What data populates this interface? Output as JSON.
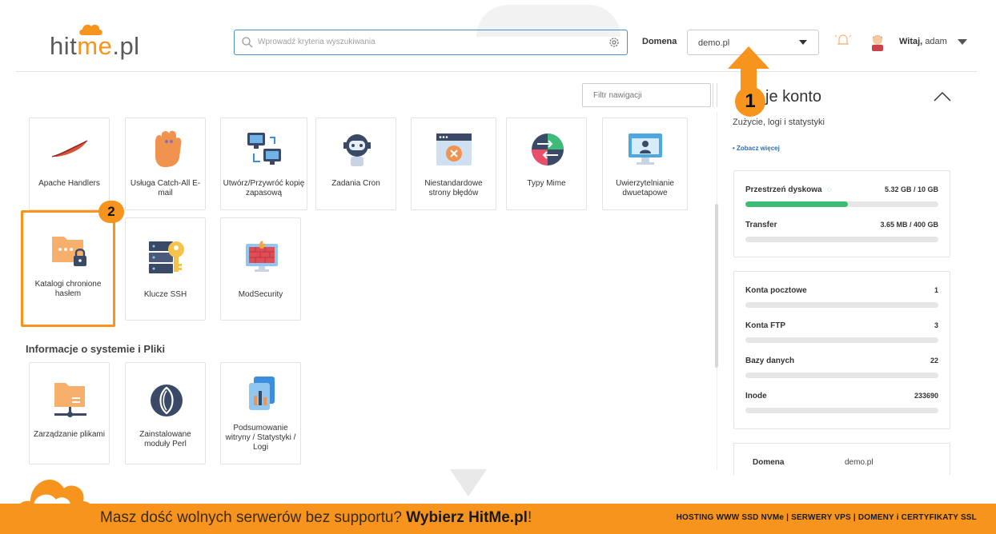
{
  "header": {
    "logo": {
      "part1": "hit",
      "part2": "me",
      "part3": ".pl"
    },
    "search": {
      "placeholder": "Wprowadź kryteria wyszukiwania"
    },
    "domain_label": "Domena",
    "domain_value": "demo.pl",
    "welcome_prefix": "Witaj,",
    "welcome_user": "adam"
  },
  "callouts": {
    "one": "1",
    "two": "2"
  },
  "filter": {
    "placeholder": "Filtr nawigacji"
  },
  "tiles_row1": [
    {
      "label": "Apache Handlers",
      "icon": "feather-icon"
    },
    {
      "label": "Usługa Catch-All E-mail",
      "icon": "glove-icon"
    },
    {
      "label": "Utwórz/Przywróć kopię zapasową",
      "icon": "backup-icon"
    },
    {
      "label": "Zadania Cron",
      "icon": "robot-icon"
    },
    {
      "label": "Niestandardowe strony błędów",
      "icon": "error-page-icon"
    },
    {
      "label": "Typy Mime",
      "icon": "mime-icon"
    },
    {
      "label": "Uwierzytelnianie dwuetapowe",
      "icon": "two-factor-icon"
    }
  ],
  "tiles_row2": [
    {
      "label": "Katalogi chronione hasłem",
      "icon": "locked-folder-icon"
    },
    {
      "label": "Klucze SSH",
      "icon": "ssh-key-icon"
    },
    {
      "label": "ModSecurity",
      "icon": "firewall-icon"
    }
  ],
  "section_info": {
    "title": "Informacje o systemie i Pliki",
    "tiles": [
      {
        "label": "Zarządzanie plikami",
        "icon": "file-manager-icon"
      },
      {
        "label": "Zainstalowane moduły Perl",
        "icon": "perl-icon"
      },
      {
        "label": "Podsumowanie witryny / Statystyki / Logi",
        "icon": "stats-icon"
      }
    ]
  },
  "account": {
    "title_suffix": "je konto",
    "subtitle": "Zużycie, logi i statystyki",
    "more_link": "• Zobacz więcej",
    "usage": [
      {
        "name": "Przestrzeń dyskowa",
        "value": "5.32 GB / 10 GB",
        "fraction": 0.53
      },
      {
        "name": "Transfer",
        "value": "3.65 MB / 400 GB",
        "fraction": 0.0
      }
    ],
    "counts": [
      {
        "name": "Konta pocztowe",
        "value": "1"
      },
      {
        "name": "Konta FTP",
        "value": "3"
      },
      {
        "name": "Bazy danych",
        "value": "22"
      },
      {
        "name": "Inode",
        "value": "233690"
      }
    ],
    "domain_key": "Domena",
    "domain_value": "demo.pl"
  },
  "banner": {
    "text_prefix": "Masz dość wolnych serwerów bez supportu?",
    "text_bold": "Wybierz HitMe.pl",
    "text_suffix": "!",
    "services": "HOSTING WWW SSD NVMe | SERWERY VPS | DOMENY i CERTYFIKATY SSL"
  },
  "colors": {
    "accent": "#f7941d",
    "link": "#2d6fb0",
    "progress": "#3dbb77",
    "search_border": "#4a90c8"
  }
}
